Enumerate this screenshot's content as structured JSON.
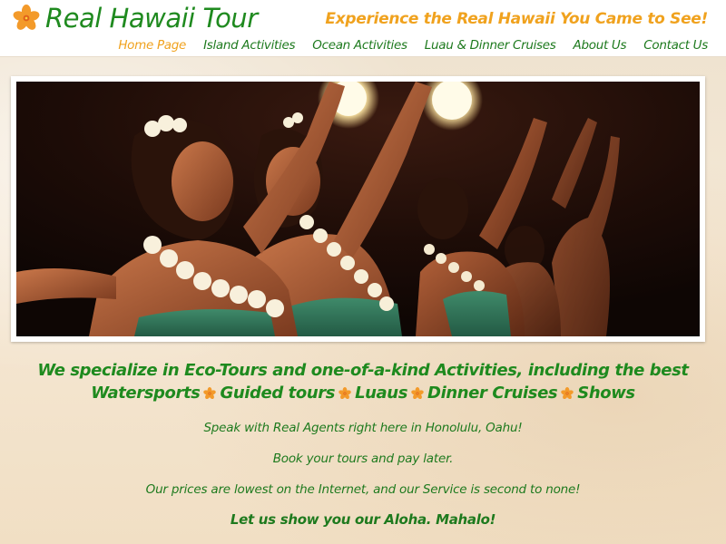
{
  "header": {
    "site_title": "Real Hawaii Tour",
    "tagline": "Experience the Real Hawaii You Came to See!",
    "logo_icon": "hibiscus-icon"
  },
  "nav": {
    "items": [
      {
        "label": "Home Page",
        "active": true
      },
      {
        "label": "Island Activities",
        "active": false
      },
      {
        "label": "Ocean Activities",
        "active": false
      },
      {
        "label": "Luau & Dinner Cruises",
        "active": false
      },
      {
        "label": "About Us",
        "active": false
      },
      {
        "label": "Contact Us",
        "active": false
      }
    ]
  },
  "hero": {
    "icon": "hula-dancers-photo"
  },
  "content": {
    "headline": "We specialize in Eco-Tours and one-of-a-kind Activities, including the best",
    "services": [
      "Watersports",
      "Guided tours",
      "Luaus",
      "Dinner Cruises",
      "Shows"
    ],
    "paragraphs": [
      "Speak with Real Agents right here in Honolulu, Oahu!",
      "Book your tours and pay later.",
      "Our prices are lowest on the Internet, and our Service is second to none!"
    ],
    "closing": "Let us show you our Aloha. Mahalo!"
  },
  "colors": {
    "green": "#1e8a1e",
    "orange": "#f0a21e",
    "background": "#f3e6d2"
  }
}
